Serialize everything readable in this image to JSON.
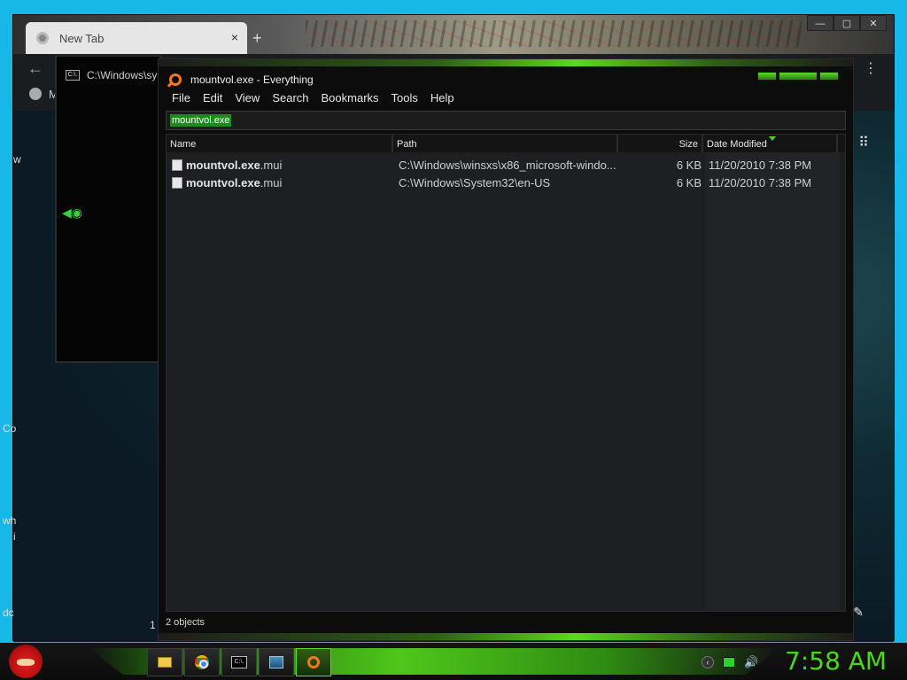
{
  "browser": {
    "tab_title": "New Tab",
    "tab_close": "×",
    "new_tab": "+",
    "window_controls": [
      "—",
      "▢",
      "✕"
    ],
    "omnibox_letter": "M",
    "menu_icon": "⋮",
    "back_icon": "←",
    "side_fragments": [
      "w",
      "Co",
      "wh",
      "i",
      "dc",
      "1"
    ]
  },
  "cmd": {
    "title": "C:\\Windows\\sys",
    "icon_text": "C:\\."
  },
  "everything": {
    "title": "mountvol.exe - Everything",
    "menu": [
      "File",
      "Edit",
      "View",
      "Search",
      "Bookmarks",
      "Tools",
      "Help"
    ],
    "search_value": "mountvol.exe",
    "columns": {
      "name": "Name",
      "path": "Path",
      "size": "Size",
      "date": "Date Modified"
    },
    "rows": [
      {
        "name_bold": "mountvol.exe",
        "name_ext": ".mui",
        "path": "C:\\Windows\\winsxs\\x86_microsoft-windo...",
        "size": "6 KB",
        "date": "11/20/2010 7:38 PM"
      },
      {
        "name_bold": "mountvol.exe",
        "name_ext": ".mui",
        "path": "C:\\Windows\\System32\\en-US",
        "size": "6 KB",
        "date": "11/20/2010 7:38 PM"
      }
    ],
    "status": "2 objects"
  },
  "taskbar": {
    "clock": "7:58 AM",
    "cmd_icon_text": "C:\\.",
    "tray_up": "‹",
    "tray_volume": "🔊"
  },
  "colors": {
    "accent_green": "#4cd61e",
    "search_orange": "#f07a1a",
    "desktop_blue": "#17b7e8"
  }
}
